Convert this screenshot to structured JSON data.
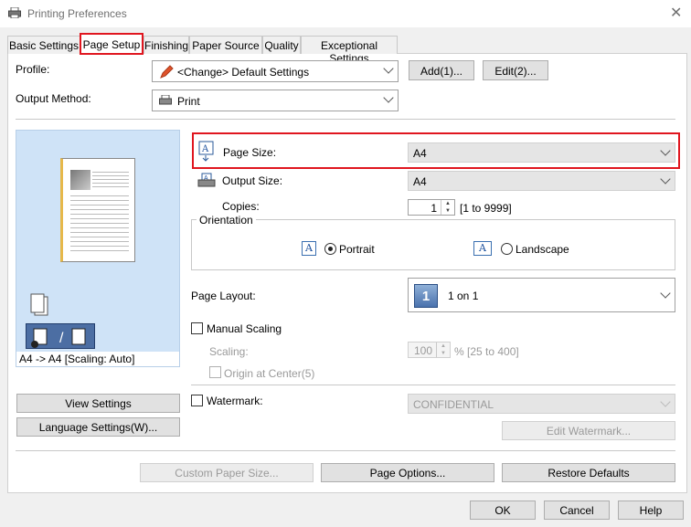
{
  "window": {
    "title": "Printing Preferences"
  },
  "tabs": [
    {
      "label": "Basic Settings"
    },
    {
      "label": "Page Setup"
    },
    {
      "label": "Finishing"
    },
    {
      "label": "Paper Source"
    },
    {
      "label": "Quality"
    },
    {
      "label": "Exceptional Settings"
    }
  ],
  "profile": {
    "label": "Profile:",
    "value": "<Change> Default Settings",
    "add_button": "Add(1)...",
    "edit_button": "Edit(2)..."
  },
  "output_method": {
    "label": "Output Method:",
    "value": "Print"
  },
  "preview": {
    "caption": "A4 -> A4 [Scaling: Auto]"
  },
  "left_buttons": {
    "view_settings": "View Settings",
    "language_settings": "Language Settings(W)..."
  },
  "page_size": {
    "label": "Page Size:",
    "value": "A4"
  },
  "output_size": {
    "label": "Output Size:",
    "value": "A4"
  },
  "copies": {
    "label": "Copies:",
    "value": "1",
    "range": "[1 to 9999]"
  },
  "orientation": {
    "label": "Orientation",
    "portrait": "Portrait",
    "landscape": "Landscape",
    "selected": "Portrait"
  },
  "page_layout": {
    "label": "Page Layout:",
    "icon_number": "1",
    "value": "1 on 1"
  },
  "manual_scaling": {
    "label": "Manual Scaling",
    "scaling_label": "Scaling:",
    "scaling_value": "100",
    "scaling_range": "% [25 to 400]",
    "origin_label": "Origin at Center(5)"
  },
  "watermark": {
    "label": "Watermark:",
    "value": "CONFIDENTIAL",
    "edit_button": "Edit Watermark..."
  },
  "bottom_buttons": {
    "custom_paper": "Custom Paper Size...",
    "page_options": "Page Options...",
    "restore_defaults": "Restore Defaults"
  },
  "dialog_buttons": {
    "ok": "OK",
    "cancel": "Cancel",
    "help": "Help"
  },
  "colors": {
    "highlight": "#e0161f",
    "preview_bg": "#cfe3f7"
  }
}
